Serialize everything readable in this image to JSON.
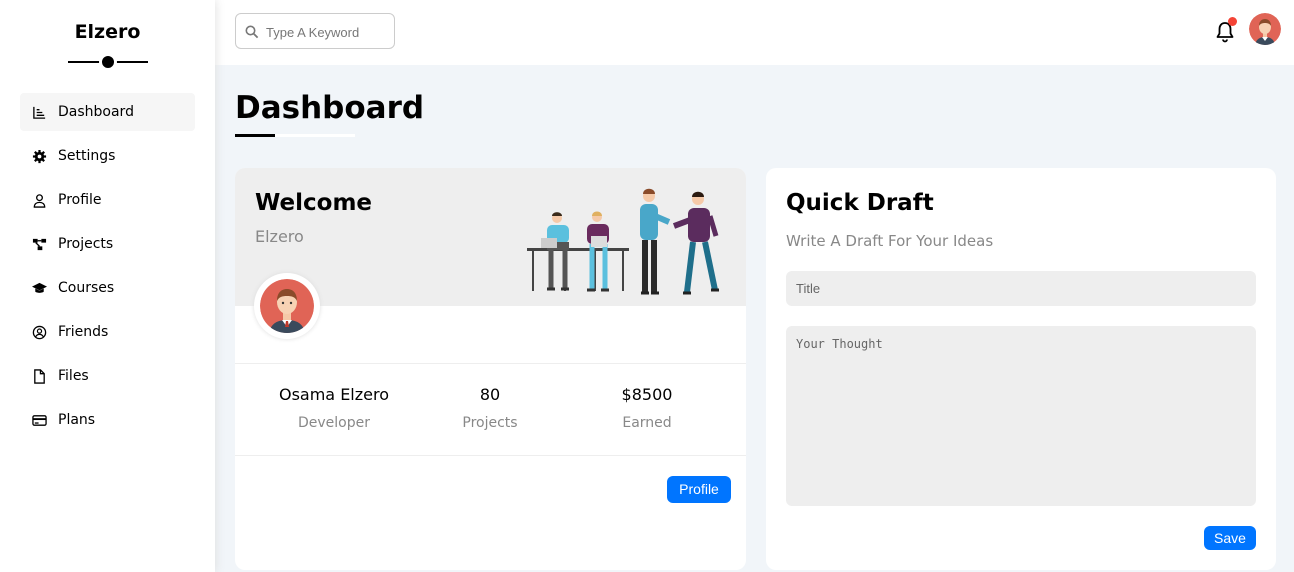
{
  "sidebar": {
    "brand": "Elzero",
    "items": [
      {
        "label": "Dashboard",
        "icon": "chart-line-icon",
        "active": true
      },
      {
        "label": "Settings",
        "icon": "gear-icon",
        "active": false
      },
      {
        "label": "Profile",
        "icon": "user-icon",
        "active": false
      },
      {
        "label": "Projects",
        "icon": "diagram-project-icon",
        "active": false
      },
      {
        "label": "Courses",
        "icon": "graduation-cap-icon",
        "active": false
      },
      {
        "label": "Friends",
        "icon": "circle-user-icon",
        "active": false
      },
      {
        "label": "Files",
        "icon": "file-icon",
        "active": false
      },
      {
        "label": "Plans",
        "icon": "credit-card-icon",
        "active": false
      }
    ]
  },
  "header": {
    "search_placeholder": "Type A Keyword",
    "notification_badge_color": "#f44336"
  },
  "page": {
    "title": "Dashboard"
  },
  "welcome": {
    "title": "Welcome",
    "subtitle": "Elzero",
    "stats": [
      {
        "value": "Osama Elzero",
        "label": "Developer"
      },
      {
        "value": "80",
        "label": "Projects"
      },
      {
        "value": "$8500",
        "label": "Earned"
      }
    ],
    "button_label": "Profile"
  },
  "draft": {
    "title": "Quick Draft",
    "subtitle": "Write A Draft For Your Ideas",
    "title_placeholder": "Title",
    "thought_placeholder": "Your Thought",
    "button_label": "Save"
  },
  "colors": {
    "accent": "#0075ff",
    "background": "#f1f5f9",
    "panel_gray": "#eeeeee"
  }
}
